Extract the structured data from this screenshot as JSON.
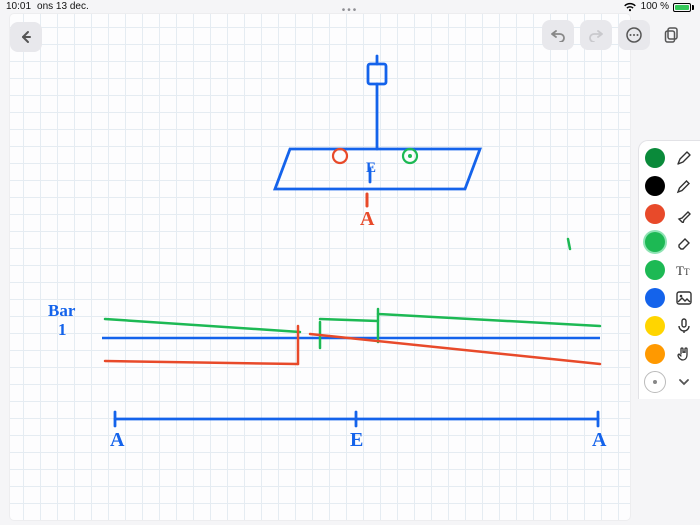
{
  "statusbar": {
    "time": "10:01",
    "date": "ons 13 dec.",
    "battery_text": "100 %"
  },
  "canvas": {
    "labels": {
      "title_bar": "Bar",
      "one": "1",
      "A_top": "A",
      "E_top": "E",
      "A_left": "A",
      "E_mid": "E",
      "A_right": "A"
    }
  },
  "toolbar": {
    "colors": [
      "dark-green",
      "black",
      "red",
      "green-ring",
      "green",
      "blue",
      "yellow",
      "orange"
    ],
    "tools": [
      "pen",
      "pencil",
      "highlighter",
      "eraser",
      "text",
      "shape",
      "mic",
      "hand"
    ]
  }
}
